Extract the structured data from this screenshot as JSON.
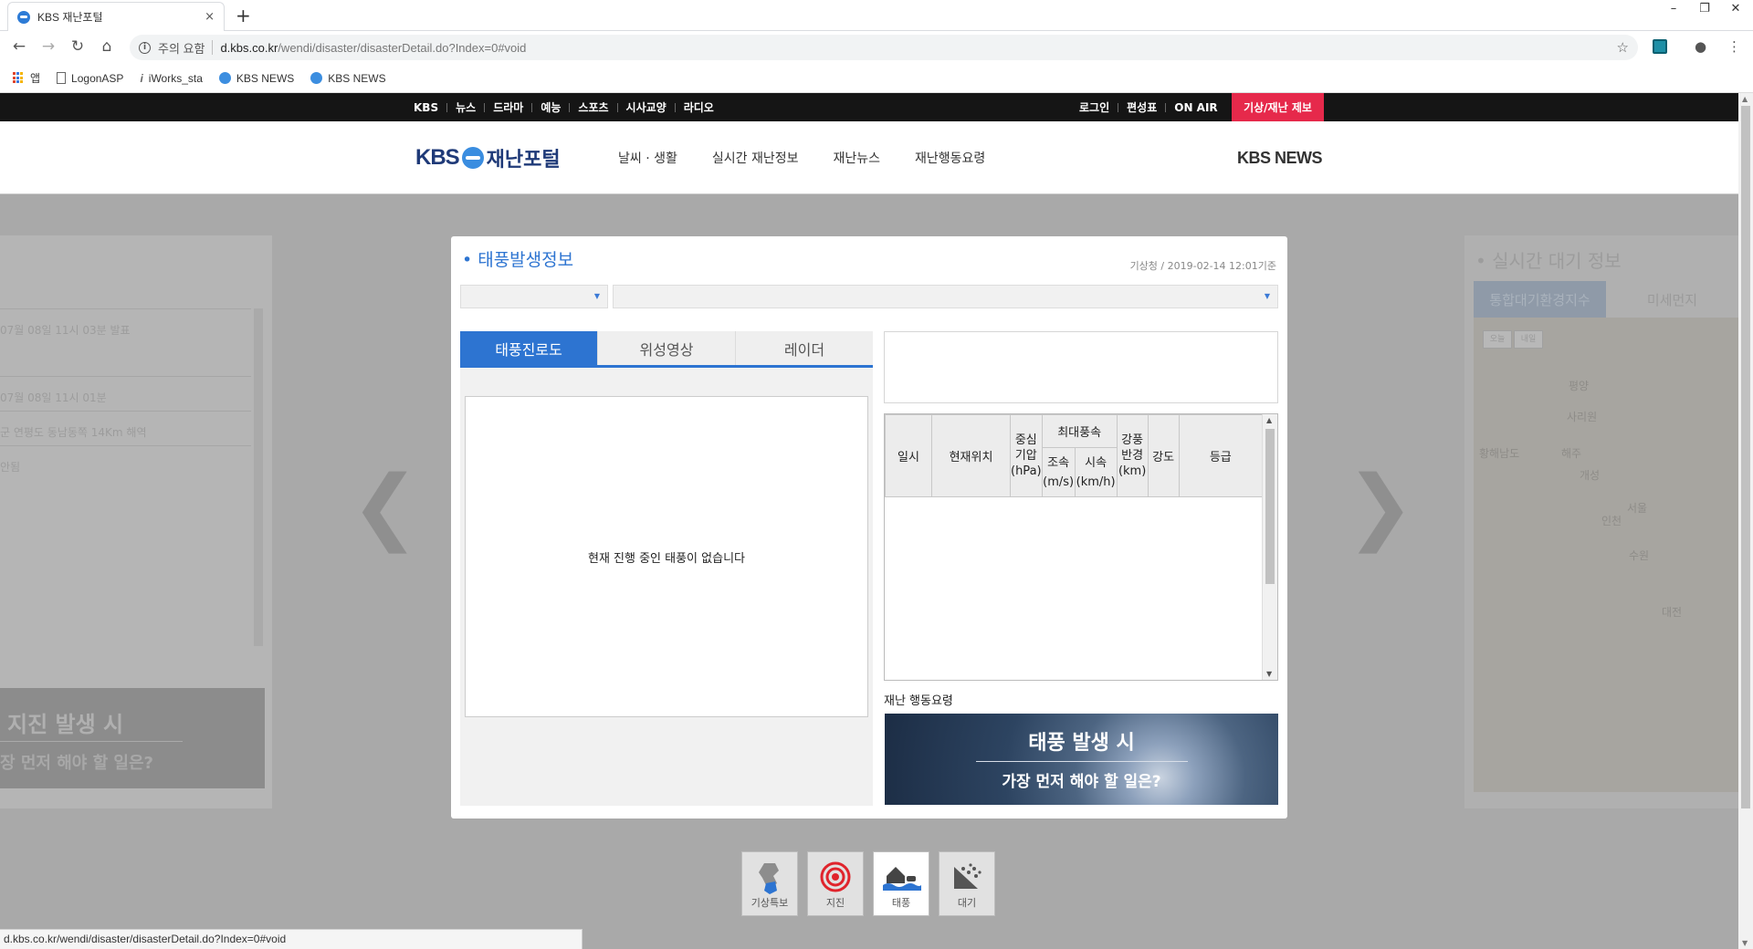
{
  "browser": {
    "tab_title": "KBS 재난포털",
    "close_tab": "×",
    "new_tab": "+",
    "window_controls": [
      "–",
      "❐",
      "✕"
    ],
    "nav": {
      "back": "←",
      "forward": "→",
      "reload": "↻",
      "home": "⌂"
    },
    "security_warning": "주의 요함",
    "url_host": "d.kbs.co.kr",
    "url_path": "/wendi/disaster/disasterDetail.do?Index=0#void",
    "star": "☆",
    "profile": "●",
    "menu": "⋮",
    "bookmarks": [
      "앱",
      "LogonASP",
      "iWorks_sta",
      "KBS NEWS",
      "KBS NEWS"
    ],
    "status_url": "d.kbs.co.kr/wendi/disaster/disasterDetail.do?Index=0#void"
  },
  "gnb": {
    "left": [
      "KBS",
      "뉴스",
      "드라마",
      "예능",
      "스포츠",
      "시사교양",
      "라디오"
    ],
    "right": [
      "로그인",
      "편성표",
      "ON AIR"
    ],
    "report": "기상/재난 제보"
  },
  "header": {
    "logo_kbs": "KBS",
    "logo_name": "재난포털",
    "nav": [
      "날씨 · 생활",
      "실시간 재난정보",
      "재난뉴스",
      "재난행동요령"
    ],
    "kbs_news": "KBS NEWS"
  },
  "left_card": {
    "rows": [
      "07월 08일 11시 03분 발표",
      "07월 08일 11시 01분",
      "군 연평도 동남동쪽 14Km 해역",
      "안됨"
    ],
    "banner_title": "지진 발생 시",
    "banner_sub": "장 먼저 해야 할 일은?"
  },
  "right_card": {
    "title": "• 실시간 대기 정보",
    "tabs": [
      "통합대기환경지수",
      "미세먼지"
    ],
    "chips": [
      "오늘",
      "내일"
    ],
    "cities": [
      "평양",
      "사리원",
      "해주",
      "황해남도",
      "개성",
      "서울",
      "인천",
      "수원",
      "대전"
    ]
  },
  "arrows": {
    "prev": "❮",
    "next": "❯"
  },
  "panel": {
    "title": "태풍발생정보",
    "date": "기상청 / 2019-02-14 12:01기준",
    "tabs": [
      "태풍진로도",
      "위성영상",
      "레이더"
    ],
    "no_typhoon": "현재 진행 중인 태풍이 없습니다",
    "table": {
      "time": "일시",
      "position": "현재위치",
      "pressure": [
        "중심",
        "기압",
        "(hPa)"
      ],
      "max_wind": "최대풍속",
      "wind_ms": [
        "조속",
        "(m/s)"
      ],
      "wind_kmh": [
        "시속",
        "(km/h)"
      ],
      "radius": [
        "강풍",
        "반경",
        "(km)"
      ],
      "strength": "강도",
      "grade": "등급"
    },
    "guide_label": "재난 행동요령",
    "guide_title": "태풍 발생 시",
    "guide_sub": "가장 먼저 해야 할 일은?"
  },
  "disaster_types": [
    "기상특보",
    "지진",
    "태풍",
    "대기"
  ]
}
